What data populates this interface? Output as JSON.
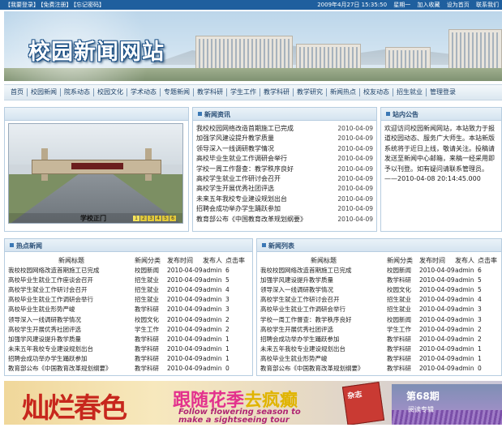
{
  "topbar": {
    "links": [
      "【我要登录】",
      "【免费注册】",
      "【忘记密码】"
    ],
    "datetime": "2009年4月27日 15:35:50",
    "weekday": "星期一",
    "actions": [
      "加入收藏",
      "设为首页",
      "联系我们"
    ]
  },
  "banner": {
    "title": "校园新闻网站"
  },
  "nav": {
    "items": [
      "首页",
      "校园新闻",
      "院系动态",
      "校园文化",
      "学术动态",
      "专题新闻",
      "教学科研",
      "学生工作",
      "教学科研",
      "教学研究",
      "新闻热点",
      "校友动态",
      "招生就业",
      "管理登录"
    ]
  },
  "news_images": {
    "title": "新闻资讯",
    "caption": "学校正门",
    "pages": [
      "1",
      "2",
      "3",
      "4",
      "5",
      "6"
    ],
    "items": [
      {
        "title": "我校校园网络改造首期施工已完成",
        "date": "2010-04-09"
      },
      {
        "title": "加强学风建设提升教学质量",
        "date": "2010-04-09"
      },
      {
        "title": "领导深入一线调研教学情况",
        "date": "2010-04-09"
      },
      {
        "title": "高校毕业生就业工作调研会举行",
        "date": "2010-04-09"
      },
      {
        "title": "学校一周工作督查：教学秩序良好",
        "date": "2010-04-09"
      },
      {
        "title": "高校学生就业工作研讨会召开",
        "date": "2010-04-09"
      },
      {
        "title": "高校学生开展优秀社团评选",
        "date": "2010-04-09"
      },
      {
        "title": "未来五年我校专业建设规划出台",
        "date": "2010-04-09"
      },
      {
        "title": "招聘会成功举办学生踊跃参加",
        "date": "2010-04-09"
      },
      {
        "title": "教育部公布《中国教育改革规划纲要》",
        "date": "2010-04-09"
      }
    ]
  },
  "notice": {
    "title": "站内公告",
    "text": "欢迎访问校园新闻网站，本站致力于报道校园动态、服务广大师生。本站新版系统将于近日上线，敬请关注。投稿请发送至新闻中心邮箱，来稿一经采用即予以刊登。如有疑问请联系管理员。——2010-04-08 20:14:45.000"
  },
  "hot_news": {
    "title": "热点新闻",
    "headers": [
      "新闻标题",
      "新闻分类",
      "发布时间",
      "发布人",
      "点击率"
    ],
    "rows": [
      [
        "我校校园网络改造首期施工已完成",
        "校园新闻",
        "2010-04-09",
        "admin",
        "6"
      ],
      [
        "高校毕业生就业工作座谈会召开",
        "招生就业",
        "2010-04-09",
        "admin",
        "5"
      ],
      [
        "高校学生就业工作研讨会召开",
        "招生就业",
        "2010-04-09",
        "admin",
        "4"
      ],
      [
        "高校毕业生就业工作调研会举行",
        "招生就业",
        "2010-04-09",
        "admin",
        "3"
      ],
      [
        "高校毕业生就业形势严峻",
        "教学科研",
        "2010-04-09",
        "admin",
        "3"
      ],
      [
        "领导深入一线调研教学情况",
        "校园文化",
        "2010-04-09",
        "admin",
        "2"
      ],
      [
        "高校学生开展优秀社团评选",
        "学生工作",
        "2010-04-09",
        "admin",
        "2"
      ],
      [
        "加强学风建设提升教学质量",
        "教学科研",
        "2010-04-09",
        "admin",
        "1"
      ],
      [
        "未来五年我校专业建设规划出台",
        "教学科研",
        "2010-04-09",
        "admin",
        "1"
      ],
      [
        "招聘会成功举办学生踊跃参加",
        "教学科研",
        "2010-04-09",
        "admin",
        "1"
      ],
      [
        "教育部公布《中国教育改革规划纲要》",
        "教学科研",
        "2010-04-09",
        "admin",
        "0"
      ]
    ]
  },
  "latest_news": {
    "title": "新闻列表",
    "headers": [
      "新闻标题",
      "新闻分类",
      "发布时间",
      "发布人",
      "点击率"
    ],
    "rows": [
      [
        "我校校园网络改造首期施工已完成",
        "校园新闻",
        "2010-04-09",
        "admin",
        "6"
      ],
      [
        "加强学风建设提升教学质量",
        "教学科研",
        "2010-04-09",
        "admin",
        "5"
      ],
      [
        "领导深入一线调研教学情况",
        "校园文化",
        "2010-04-09",
        "admin",
        "5"
      ],
      [
        "高校学生就业工作研讨会召开",
        "招生就业",
        "2010-04-09",
        "admin",
        "4"
      ],
      [
        "高校毕业生就业工作调研会举行",
        "招生就业",
        "2010-04-09",
        "admin",
        "3"
      ],
      [
        "学校一周工作督查：教学秩序良好",
        "校园新闻",
        "2010-04-09",
        "admin",
        "3"
      ],
      [
        "高校学生开展优秀社团评选",
        "学生工作",
        "2010-04-09",
        "admin",
        "2"
      ],
      [
        "招聘会成功举办学生踊跃参加",
        "教学科研",
        "2010-04-09",
        "admin",
        "2"
      ],
      [
        "未来五年我校专业建设规划出台",
        "教学科研",
        "2010-04-09",
        "admin",
        "1"
      ],
      [
        "高校毕业生就业形势严峻",
        "教学科研",
        "2010-04-09",
        "admin",
        "1"
      ],
      [
        "教育部公布《中国教育改革规划纲要》",
        "教学科研",
        "2010-04-09",
        "admin",
        "0"
      ]
    ]
  },
  "ad": {
    "calligraphy": "灿烂春色",
    "slogan_a": "跟随花季",
    "slogan_b": "去疯癫",
    "english_1": "Follow flowering season to",
    "english_2": "make a sightseeing tour",
    "magazine": "杂志",
    "issue": "第68期",
    "issue_sub": "阅读专辑"
  }
}
